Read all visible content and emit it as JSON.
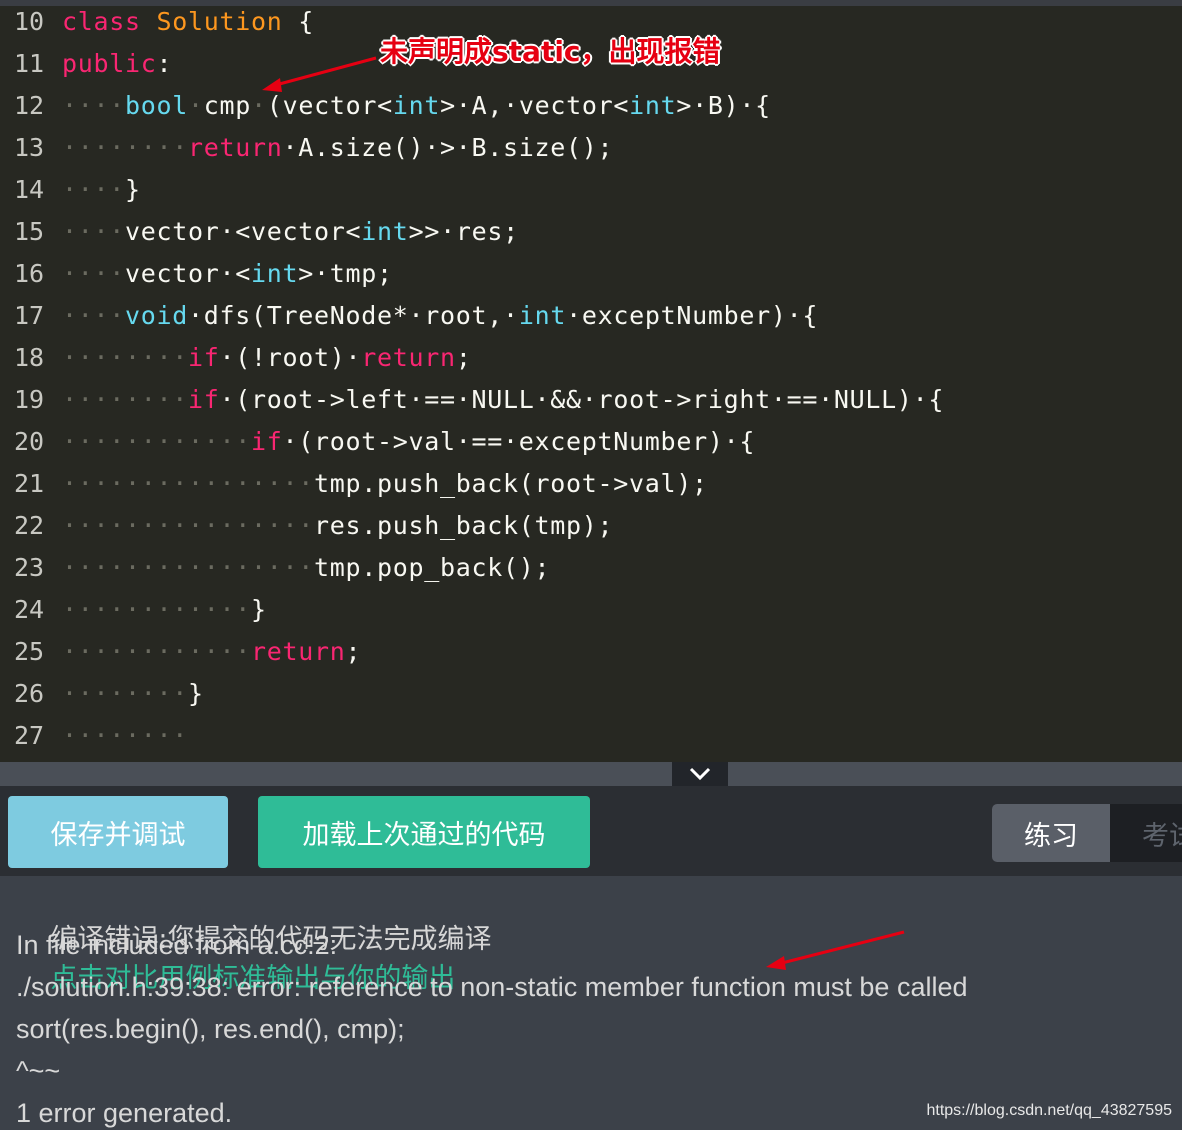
{
  "editor": {
    "lines": [
      {
        "n": "10",
        "segs": [
          [
            "class",
            "kw"
          ],
          [
            " ",
            "ws"
          ],
          [
            "Solution",
            "cls"
          ],
          [
            " {",
            ""
          ]
        ]
      },
      {
        "n": "11",
        "segs": [
          [
            "public",
            "kw"
          ],
          [
            ":",
            ""
          ]
        ]
      },
      {
        "n": "12",
        "segs": [
          [
            "····",
            "ws"
          ],
          [
            "bool",
            "ty"
          ],
          [
            "·",
            "ws"
          ],
          [
            "cmp",
            ""
          ],
          [
            "·",
            "ws"
          ],
          [
            "(vector<",
            ""
          ],
          [
            "int",
            "ty"
          ],
          [
            ">·A,·vector<",
            ""
          ],
          [
            "int",
            "ty"
          ],
          [
            ">·B)·{",
            ""
          ]
        ]
      },
      {
        "n": "13",
        "segs": [
          [
            "········",
            "ws"
          ],
          [
            "return",
            "kw"
          ],
          [
            "·A.size()·>·B.size();",
            ""
          ]
        ]
      },
      {
        "n": "14",
        "segs": [
          [
            "····",
            "ws"
          ],
          [
            "}",
            ""
          ]
        ]
      },
      {
        "n": "15",
        "segs": [
          [
            "····",
            "ws"
          ],
          [
            "vector·<vector<",
            ""
          ],
          [
            "int",
            "ty"
          ],
          [
            ">>·res;",
            ""
          ]
        ]
      },
      {
        "n": "16",
        "segs": [
          [
            "····",
            "ws"
          ],
          [
            "vector·<",
            ""
          ],
          [
            "int",
            "ty"
          ],
          [
            ">·tmp;",
            ""
          ]
        ]
      },
      {
        "n": "17",
        "segs": [
          [
            "····",
            "ws"
          ],
          [
            "void",
            "ty"
          ],
          [
            "·dfs(TreeNode*·root,·",
            ""
          ],
          [
            "int",
            "ty"
          ],
          [
            "·exceptNumber)·{",
            ""
          ]
        ]
      },
      {
        "n": "18",
        "segs": [
          [
            "········",
            "ws"
          ],
          [
            "if",
            "kw"
          ],
          [
            "·(!root)·",
            ""
          ],
          [
            "return",
            "kw"
          ],
          [
            ";",
            ""
          ]
        ]
      },
      {
        "n": "19",
        "segs": [
          [
            "········",
            "ws"
          ],
          [
            "if",
            "kw"
          ],
          [
            "·(root->left·==·NULL·&&·root->right·==·NULL)·{",
            ""
          ]
        ]
      },
      {
        "n": "20",
        "segs": [
          [
            "············",
            "ws"
          ],
          [
            "if",
            "kw"
          ],
          [
            "·(root->val·==·exceptNumber)·{",
            ""
          ]
        ]
      },
      {
        "n": "21",
        "segs": [
          [
            "················",
            "ws"
          ],
          [
            "tmp.push_back(root->val);",
            ""
          ]
        ]
      },
      {
        "n": "22",
        "segs": [
          [
            "················",
            "ws"
          ],
          [
            "res.push_back(tmp);",
            ""
          ]
        ]
      },
      {
        "n": "23",
        "segs": [
          [
            "················",
            "ws"
          ],
          [
            "tmp.pop_back();",
            ""
          ]
        ]
      },
      {
        "n": "24",
        "segs": [
          [
            "············",
            "ws"
          ],
          [
            "}",
            ""
          ]
        ]
      },
      {
        "n": "25",
        "segs": [
          [
            "············",
            "ws"
          ],
          [
            "return",
            "kw"
          ],
          [
            ";",
            ""
          ]
        ]
      },
      {
        "n": "26",
        "segs": [
          [
            "········",
            "ws"
          ],
          [
            "}",
            ""
          ]
        ]
      },
      {
        "n": "27",
        "segs": [
          [
            "········",
            "ws"
          ]
        ]
      }
    ]
  },
  "annotation": {
    "text": "未声明成static，出现报错"
  },
  "toolbar": {
    "save_label": "保存并调试",
    "load_label": "加载上次通过的代码",
    "tab_practice": "练习",
    "tab_exam": "考试"
  },
  "output": {
    "compile_error": "编译错误:您提交的代码无法完成编译",
    "compare_link": "点击对比用例标准输出与你的输出",
    "lines": [
      "In file included from a.cc:2:",
      "./solution.h:39:38: error: reference to non-static member function must be called",
      "sort(res.begin(), res.end(), cmp);",
      "^~~",
      "1 error generated."
    ]
  },
  "watermark": "https://blog.csdn.net/qq_43827595",
  "colors": {
    "keyword": "#f92672",
    "type": "#66d9ef",
    "class_name": "#fd971f",
    "accent_blue": "#7ecbe0",
    "accent_green": "#2fbc97"
  }
}
